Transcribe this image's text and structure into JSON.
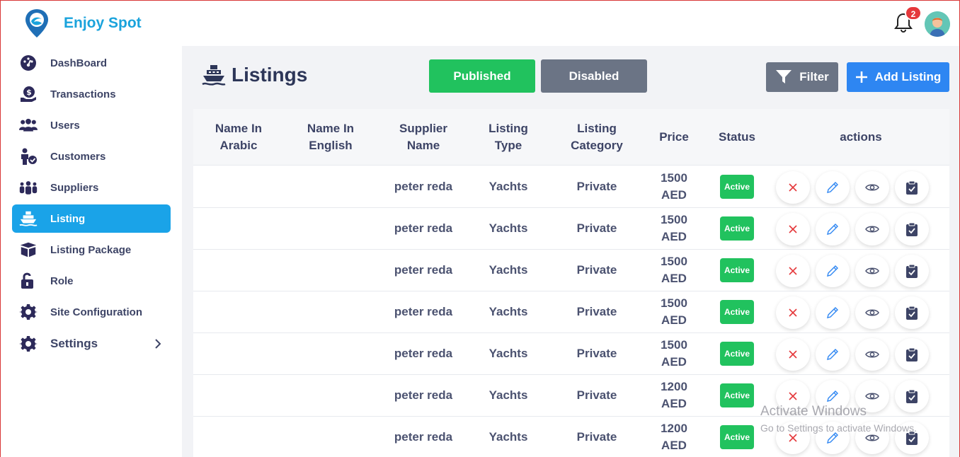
{
  "app": {
    "brand": "Enjoy Spot"
  },
  "header": {
    "notification_count": "2"
  },
  "sidebar": {
    "items": [
      {
        "label": "DashBoard",
        "icon": "dashboard-gauge-icon"
      },
      {
        "label": "Transactions",
        "icon": "money-hand-icon"
      },
      {
        "label": "Users",
        "icon": "users-group-icon"
      },
      {
        "label": "Customers",
        "icon": "customer-check-icon"
      },
      {
        "label": "Suppliers",
        "icon": "suppliers-group-icon"
      },
      {
        "label": "Listing",
        "icon": "ship-icon",
        "active": true
      },
      {
        "label": "Listing Package",
        "icon": "box-icon"
      },
      {
        "label": "Role",
        "icon": "unlock-icon"
      },
      {
        "label": "Site Configuration",
        "icon": "gear-icon"
      },
      {
        "label": "Settings",
        "icon": "gear-icon",
        "has_submenu": true
      }
    ]
  },
  "page": {
    "title": "Listings",
    "tabs": {
      "published": "Published",
      "disabled": "Disabled"
    },
    "filter_label": "Filter",
    "add_label": "Add Listing"
  },
  "table": {
    "columns": {
      "name_ar": "Name In Arabic",
      "name_en": "Name In English",
      "supplier": "Supplier Name",
      "type": "Listing Type",
      "category": "Listing Category",
      "price": "Price",
      "status": "Status",
      "actions": "actions"
    },
    "rows": [
      {
        "name_ar": "",
        "name_en": "",
        "supplier": "peter reda",
        "type": "Yachts",
        "category": "Private",
        "price": "1500 AED",
        "status": "Active"
      },
      {
        "name_ar": "",
        "name_en": "",
        "supplier": "peter reda",
        "type": "Yachts",
        "category": "Private",
        "price": "1500 AED",
        "status": "Active"
      },
      {
        "name_ar": "",
        "name_en": "",
        "supplier": "peter reda",
        "type": "Yachts",
        "category": "Private",
        "price": "1500 AED",
        "status": "Active"
      },
      {
        "name_ar": "",
        "name_en": "",
        "supplier": "peter reda",
        "type": "Yachts",
        "category": "Private",
        "price": "1500 AED",
        "status": "Active"
      },
      {
        "name_ar": "",
        "name_en": "",
        "supplier": "peter reda",
        "type": "Yachts",
        "category": "Private",
        "price": "1500 AED",
        "status": "Active"
      },
      {
        "name_ar": "",
        "name_en": "",
        "supplier": "peter reda",
        "type": "Yachts",
        "category": "Private",
        "price": "1200 AED",
        "status": "Active"
      },
      {
        "name_ar": "",
        "name_en": "",
        "supplier": "peter reda",
        "type": "Yachts",
        "category": "Private",
        "price": "1200 AED",
        "status": "Active"
      }
    ]
  },
  "watermark": {
    "line1": "Activate Windows",
    "line2": "Go to Settings to activate Windows."
  },
  "colors": {
    "brand": "#1aa3dc",
    "active_nav": "#1aa3e8",
    "published": "#21c25e",
    "neutral_btn": "#6b7485",
    "add_btn": "#2e86f2",
    "delete": "#e5383b",
    "edit": "#2e86f2"
  }
}
